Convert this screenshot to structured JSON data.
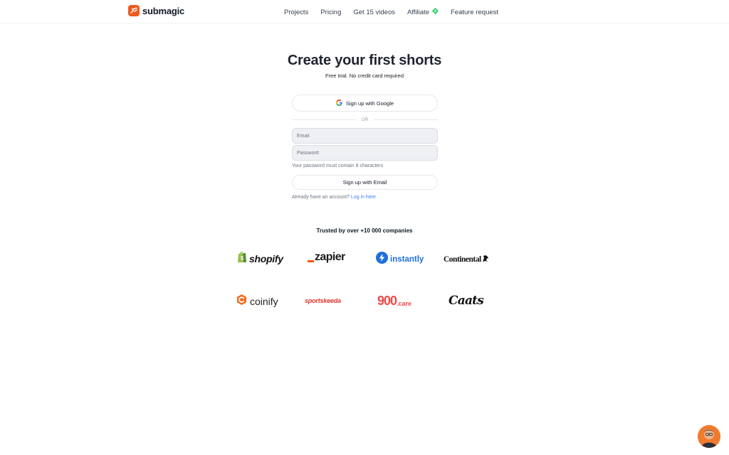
{
  "brand": {
    "name": "submagic",
    "accent": "#f05a1f"
  },
  "nav": {
    "items": [
      {
        "label": "Projects"
      },
      {
        "label": "Pricing"
      },
      {
        "label": "Get 15 videos"
      },
      {
        "label": "Affiliate",
        "icon": "diamond-icon"
      },
      {
        "label": "Feature request"
      }
    ]
  },
  "signup": {
    "title": "Create your first shorts",
    "subtitle": "Free trial. No credit card required",
    "google_label": "Sign up with Google",
    "divider": "OR",
    "email_placeholder": "Email",
    "email_value": "",
    "password_placeholder": "Password",
    "password_value": "",
    "password_hint": "Your password must contain 8 characters",
    "email_button": "Sign up with Email",
    "login_prompt": "Already have an account?",
    "login_link": "Log in here",
    "link_color": "#3b82f6"
  },
  "trusted": {
    "heading": "Trusted by over +10 000 companies",
    "logos": [
      {
        "name": "shopify",
        "text": "shopify"
      },
      {
        "name": "zapier",
        "text": "zapier"
      },
      {
        "name": "instantly",
        "text": "instantly"
      },
      {
        "name": "continental",
        "text": "Continental"
      },
      {
        "name": "coinify",
        "text": "coinify"
      },
      {
        "name": "sportskeeda",
        "text": "sportskeeda"
      },
      {
        "name": "900care",
        "text_main": "900",
        "text_suffix": ".care"
      },
      {
        "name": "caats",
        "text": "Caats"
      }
    ]
  }
}
